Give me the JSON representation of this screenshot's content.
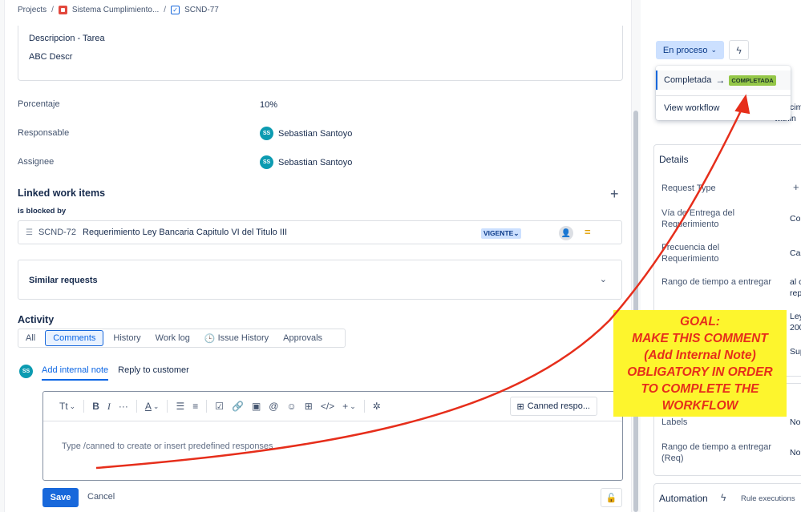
{
  "breadcrumb": {
    "projects": "Projects",
    "project": "Sistema Cumplimiento...",
    "issue": "SCND-77",
    "sep": "/"
  },
  "description": {
    "title": "Descripcion - Tarea",
    "value": "ABC Descr"
  },
  "fields": [
    {
      "label": "Porcentaje",
      "value": "10%"
    },
    {
      "label": "Responsable",
      "value": "Sebastian Santoyo",
      "avatar": "SS"
    },
    {
      "label": "Assignee",
      "value": "Sebastian Santoyo",
      "avatar": "SS"
    }
  ],
  "linked": {
    "title": "Linked work items",
    "relation": "is blocked by",
    "item_key": "SCND-72",
    "item_summary": "Requerimiento Ley Bancaria Capitulo VI del Titulo III",
    "item_status": "VIGENTE"
  },
  "similar": {
    "label": "Similar requests"
  },
  "activity": {
    "title": "Activity",
    "tabs": [
      "All",
      "Comments",
      "History",
      "Work log",
      "Issue History",
      "Approvals"
    ],
    "active_tab": "Comments"
  },
  "comment": {
    "avatar": "SS",
    "tab_internal": "Add internal note",
    "tab_reply": "Reply to customer",
    "toolbar_text": "Tt",
    "canned": "Canned respo...",
    "placeholder": "Type /canned to create or insert predefined responses",
    "save": "Save",
    "cancel": "Cancel"
  },
  "right_panel": {
    "status": "En proceso",
    "menu_transition": "Completada",
    "menu_badge": "COMPLETADA",
    "menu_view": "View workflow",
    "cut_text_1": "cim",
    "cut_text_2": "within",
    "details_title": "Details",
    "details": [
      {
        "label": "Request Type",
        "value": "+"
      },
      {
        "label": "Vía de Entrega del Requerimiento",
        "value": "Co"
      },
      {
        "label": "Frecuencia del Requerimiento",
        "value": "Ca"
      },
      {
        "label": "Rango de tiempo a entregar",
        "value": "al c",
        "value2": "rep"
      },
      {
        "value": "Ley",
        "value2": "200"
      },
      {
        "value": "Sup"
      },
      {
        "label": "Labels",
        "value": "No"
      },
      {
        "label": "Rango de tiempo a entregar (Req)",
        "value": "No"
      }
    ],
    "automation": "Automation",
    "rule_exec": "Rule executions"
  },
  "goal_note": {
    "lines": [
      "GOAL:",
      "MAKE THIS COMMENT",
      "(Add Internal Note)",
      "OBLIGATORY IN ORDER",
      "TO COMPLETE THE",
      "WORKFLOW"
    ],
    "color": "#e62e1b",
    "background": "#fdf52d"
  },
  "colors": {
    "primary": "#1868db",
    "arrow": "#e62e1b"
  }
}
